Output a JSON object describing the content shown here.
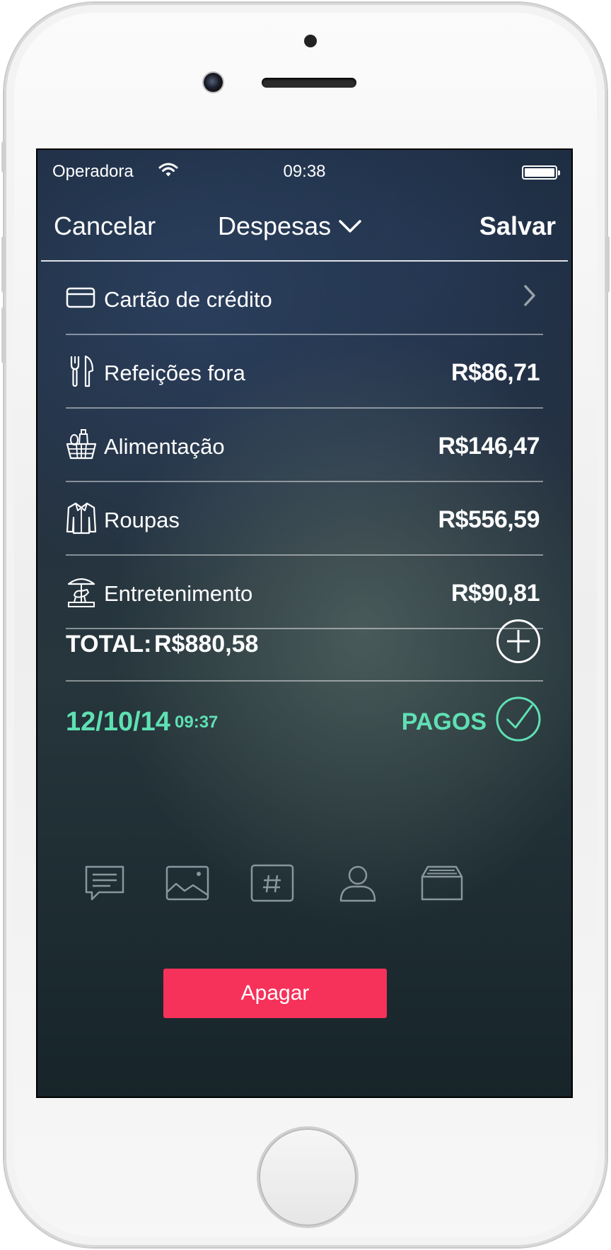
{
  "status_bar": {
    "carrier": "Operadora",
    "time": "09:38"
  },
  "nav": {
    "cancel_label": "Cancelar",
    "title": "Despesas",
    "save_label": "Salvar"
  },
  "payment_method": {
    "label": "Cartão de crédito",
    "icon": "credit-card-icon"
  },
  "categories": [
    {
      "label": "Refeições fora",
      "amount": "R$86,71",
      "icon": "fork-knife-icon"
    },
    {
      "label": "Alimentação",
      "amount": "R$146,47",
      "icon": "grocery-basket-icon"
    },
    {
      "label": "Roupas",
      "amount": "R$556,59",
      "icon": "shirt-icon"
    },
    {
      "label": "Entretenimento",
      "amount": "R$90,81",
      "icon": "carousel-icon"
    }
  ],
  "total": {
    "label": "TOTAL:",
    "value": "R$880,58"
  },
  "date": {
    "date": "12/10/14",
    "time": "09:37",
    "status": "PAGOS"
  },
  "toolbar": [
    "comment-icon",
    "image-icon",
    "hashtag-icon",
    "person-icon",
    "archive-icon"
  ],
  "delete_label": "Apagar",
  "colors": {
    "accent_green": "#5fe0b3",
    "delete_red": "#f6315a"
  }
}
